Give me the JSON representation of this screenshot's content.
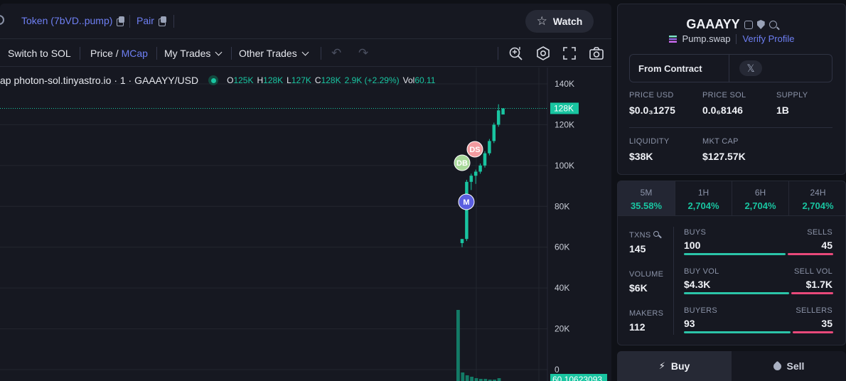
{
  "header": {
    "token_link": "Token (7bVD..pump)",
    "pair_link": "Pair",
    "watch_label": "Watch"
  },
  "toolbar": {
    "switch_label": "Switch to SOL",
    "price_label": "Price",
    "slash": "/",
    "mcap_label": "MCap",
    "my_trades": "My Trades",
    "other_trades": "Other Trades"
  },
  "chart": {
    "title": "ap photon-sol.tinyastro.io · 1 · GAAAYY/USD",
    "ohlc": [
      {
        "key": "O",
        "value": "125K"
      },
      {
        "key": "H",
        "value": "128K"
      },
      {
        "key": "L",
        "value": "127K"
      },
      {
        "key": "C",
        "value": "128K"
      }
    ],
    "change": "2.9K (+2.29%)",
    "vol_key": "Vol",
    "vol_value": "60.11",
    "price_tag": "128K",
    "volume_tag": "60.10623093",
    "markers": {
      "ds": "DS",
      "db": "DB",
      "m": "M"
    },
    "colors": {
      "up": "#19c5a1",
      "grid": "#23262f"
    }
  },
  "chart_data": {
    "type": "bar",
    "y_ticks": [
      "140K",
      "120K",
      "100K",
      "80K",
      "60K",
      "40K",
      "20K",
      "0"
    ],
    "ylim": [
      0,
      140000
    ],
    "last_price": "128K",
    "candles_mcap": [
      {
        "o": 62000,
        "h": 64000,
        "l": 60000,
        "c": 64000
      },
      {
        "o": 64000,
        "h": 93000,
        "l": 63000,
        "c": 92000
      },
      {
        "o": 92000,
        "h": 96000,
        "l": 88000,
        "c": 95000
      },
      {
        "o": 95000,
        "h": 98000,
        "l": 91000,
        "c": 97000
      },
      {
        "o": 97000,
        "h": 101000,
        "l": 96000,
        "c": 100000
      },
      {
        "o": 100000,
        "h": 107000,
        "l": 99000,
        "c": 106000
      },
      {
        "o": 106000,
        "h": 113000,
        "l": 105000,
        "c": 112000
      },
      {
        "o": 112000,
        "h": 121000,
        "l": 111000,
        "c": 120000
      },
      {
        "o": 120000,
        "h": 130000,
        "l": 119000,
        "c": 127000
      },
      {
        "o": 125000,
        "h": 128000,
        "l": 127000,
        "c": 128000
      }
    ]
  },
  "token": {
    "name": "GAAAYY",
    "platform": "Pump.swap",
    "verify": "Verify Profile",
    "from_contract": "From Contract",
    "x_label": "𝕏",
    "stats": [
      {
        "label": "PRICE USD",
        "value": "$0.0₃1275"
      },
      {
        "label": "PRICE SOL",
        "value": "0.0₆8146"
      },
      {
        "label": "SUPPLY",
        "value": "1B"
      },
      {
        "label": "LIQUIDITY",
        "value": "$38K"
      },
      {
        "label": "MKT CAP",
        "value": "$127.57K"
      }
    ]
  },
  "timeframes": [
    {
      "label": "5M",
      "value": "35.58%"
    },
    {
      "label": "1H",
      "value": "2,704%"
    },
    {
      "label": "6H",
      "value": "2,704%"
    },
    {
      "label": "24H",
      "value": "2,704%"
    }
  ],
  "metrics": {
    "txns_label": "TXNS",
    "txns": "145",
    "volume_label": "VOLUME",
    "volume": "$6K",
    "makers_label": "MAKERS",
    "makers": "112",
    "buys_label": "BUYS",
    "buys": "100",
    "sells_label": "SELLS",
    "sells": "45",
    "buy_vol_label": "BUY VOL",
    "buy_vol": "$4.3K",
    "sell_vol_label": "SELL VOL",
    "sell_vol": "$1.7K",
    "buyers_label": "BUYERS",
    "buyers": "93",
    "sellers_label": "SELLERS",
    "sellers": "35"
  },
  "trade": {
    "buy_label": "Buy",
    "sell_label": "Sell"
  }
}
